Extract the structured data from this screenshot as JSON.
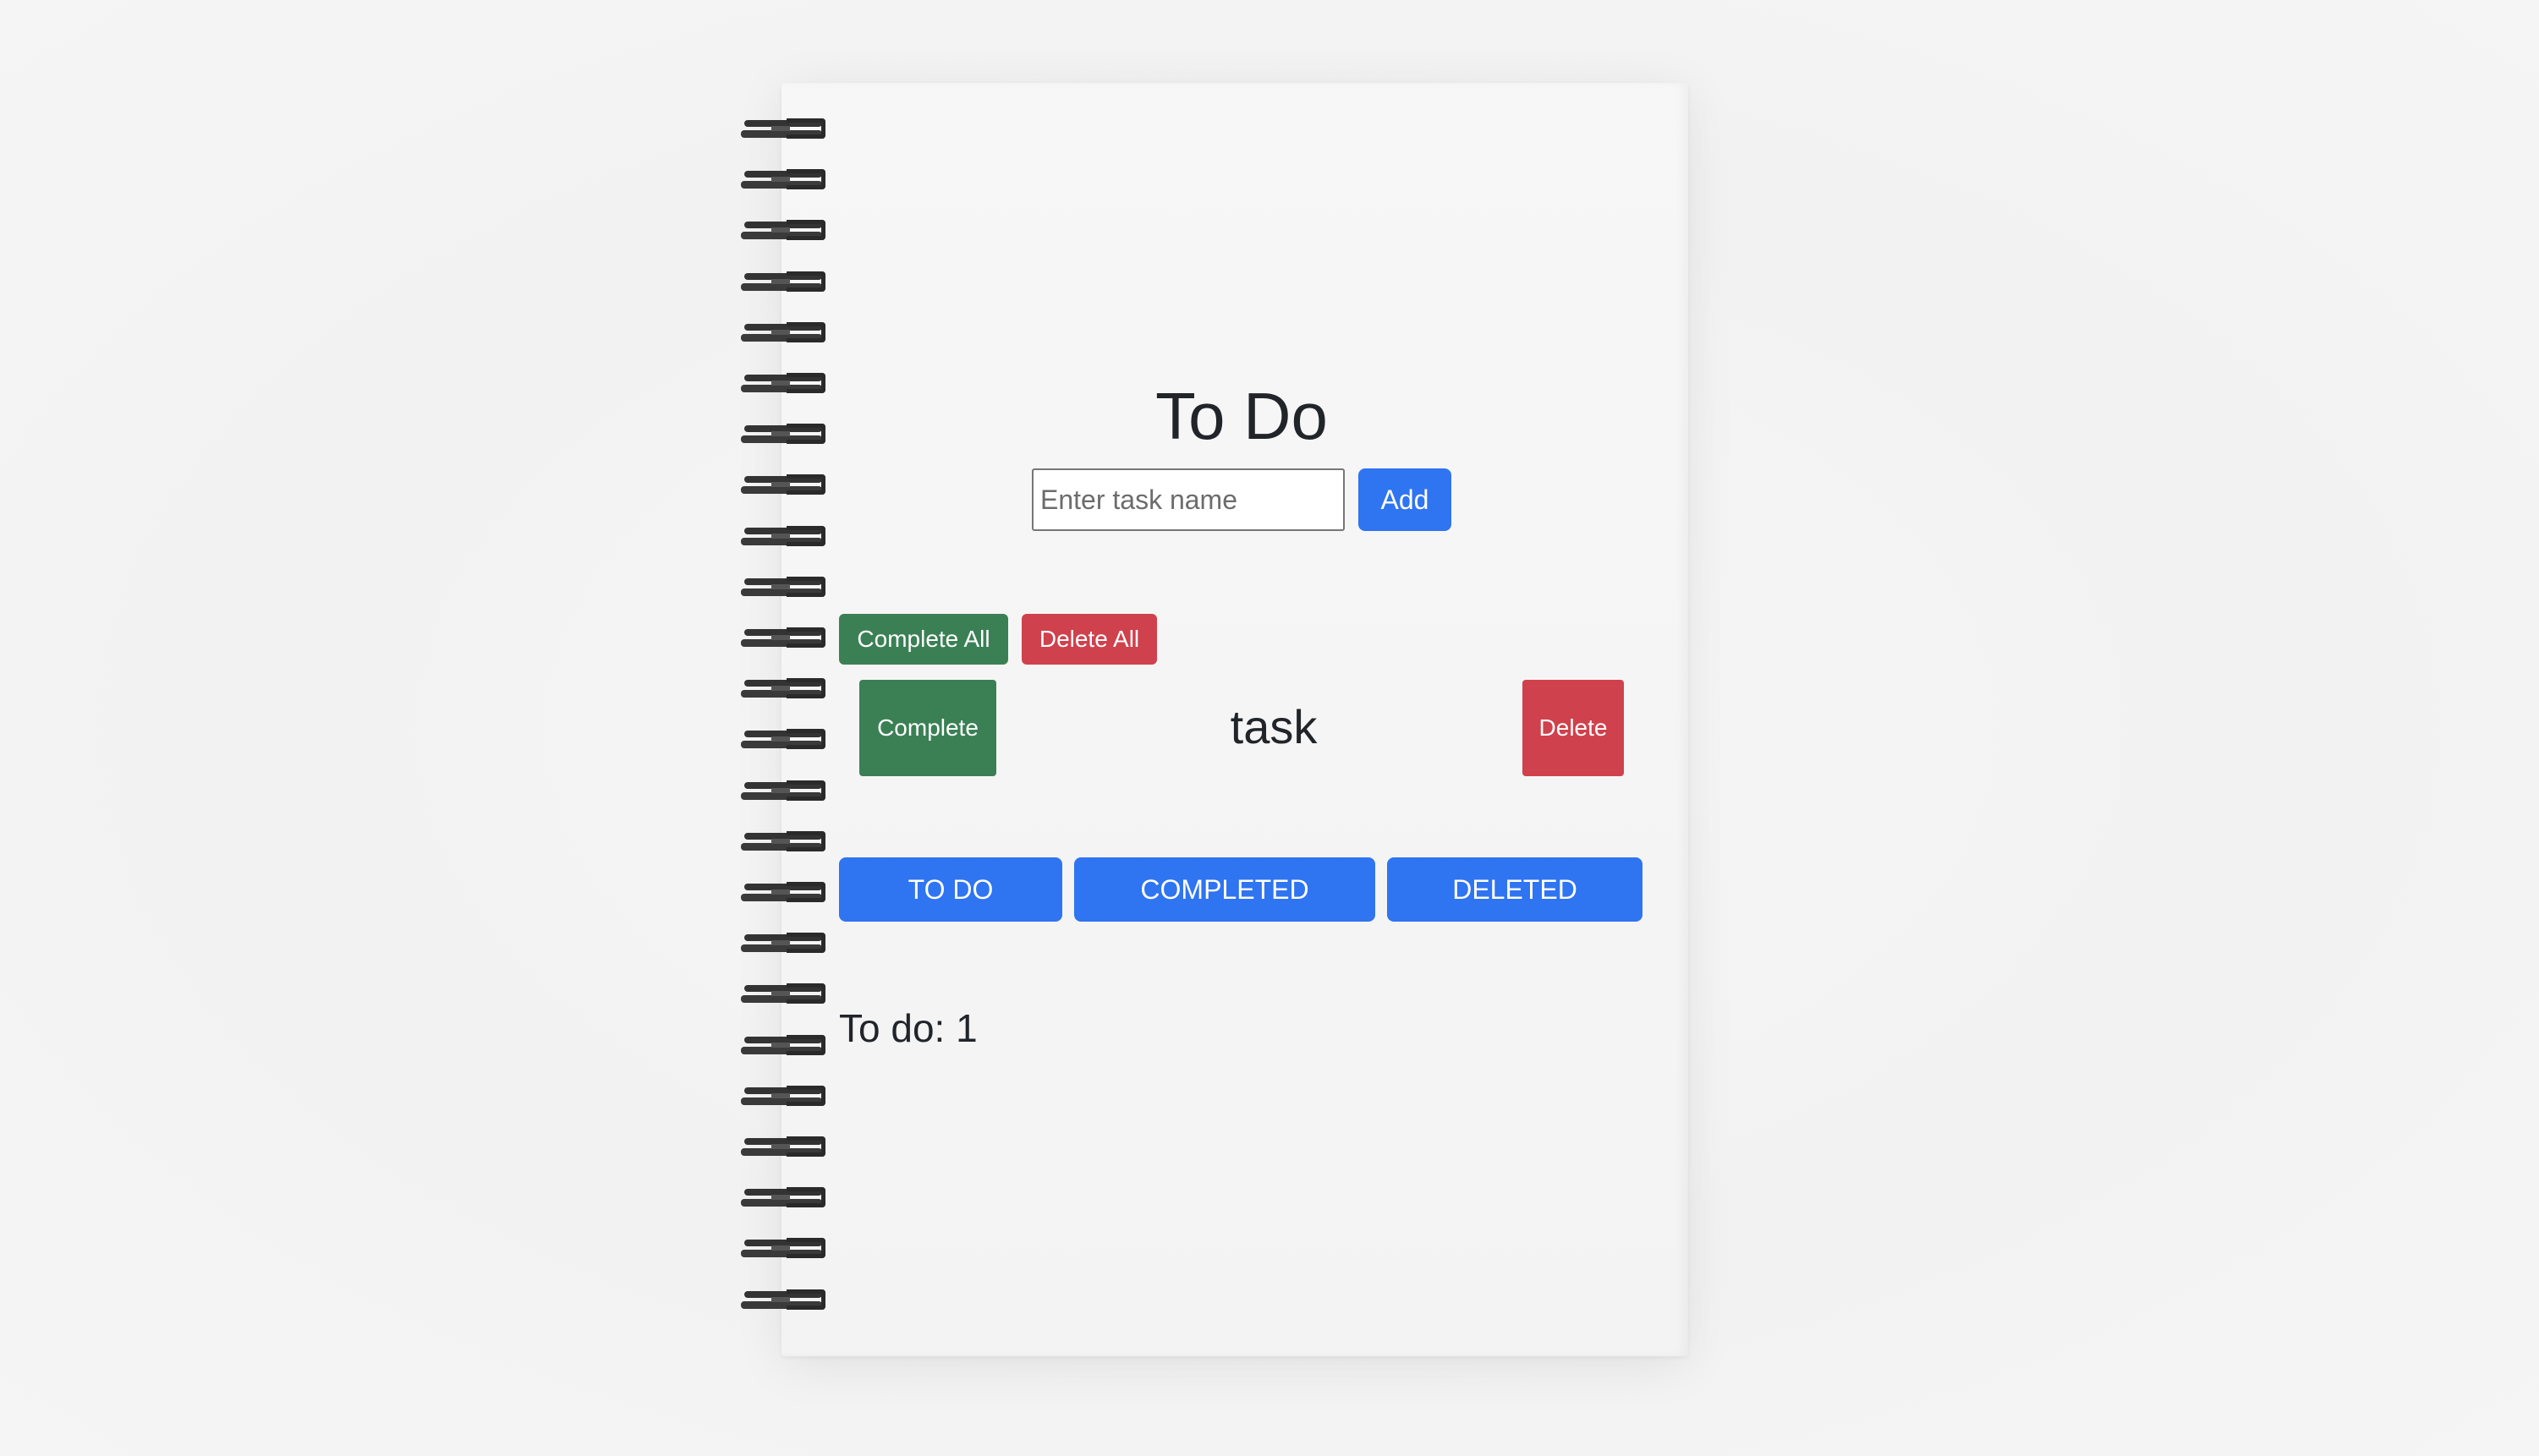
{
  "app": {
    "title": "To Do"
  },
  "form": {
    "input_placeholder": "Enter task name",
    "input_value": "",
    "add_label": "Add"
  },
  "bulk_actions": {
    "complete_all_label": "Complete All",
    "delete_all_label": "Delete All"
  },
  "tasks": [
    {
      "name": "task",
      "complete_label": "Complete",
      "delete_label": "Delete"
    }
  ],
  "tabs": [
    {
      "label": "TO DO"
    },
    {
      "label": "COMPLETED"
    },
    {
      "label": "DELETED"
    }
  ],
  "status": {
    "todo_count_text": "To do: 1"
  },
  "colors": {
    "primary": "#2f74f1",
    "success": "#3b8055",
    "danger": "#cf414c",
    "text": "#212529",
    "page_background": "#f3f3f3",
    "notebook_paper": "#f5f5f5"
  },
  "icons": {
    "binding": "spiral-binding"
  }
}
